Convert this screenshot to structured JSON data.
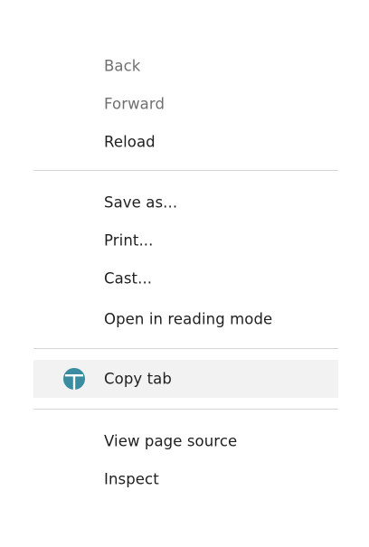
{
  "menu": {
    "groups": [
      {
        "items": [
          {
            "label": "Back",
            "disabled": true
          },
          {
            "label": "Forward",
            "disabled": true
          },
          {
            "label": "Reload",
            "disabled": false
          }
        ]
      },
      {
        "items": [
          {
            "label": "Save as..."
          },
          {
            "label": "Print..."
          },
          {
            "label": "Cast..."
          },
          {
            "label": "Open in reading mode"
          }
        ]
      },
      {
        "items": [
          {
            "label": "Copy tab",
            "icon": "copy-tab-extension-icon",
            "highlighted": true
          }
        ]
      },
      {
        "items": [
          {
            "label": "View page source"
          },
          {
            "label": "Inspect"
          }
        ]
      }
    ]
  },
  "colors": {
    "text": "#1f1f1f",
    "disabled_text": "#707070",
    "hover_bg": "#f2f2f2",
    "separator": "#d6d6d6",
    "icon_accent": "#3a8ca0"
  }
}
